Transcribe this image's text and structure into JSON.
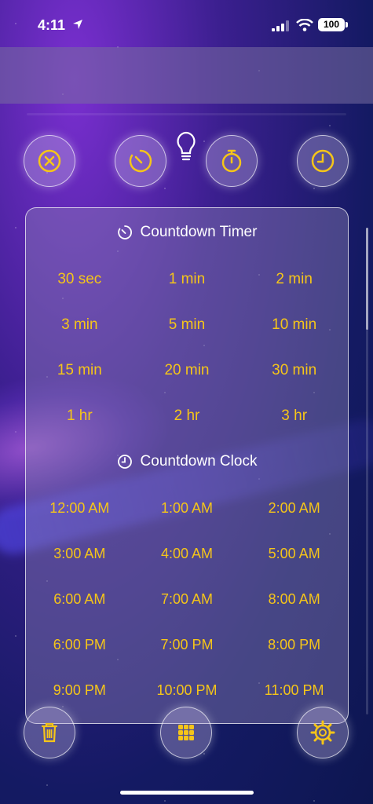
{
  "status_bar": {
    "time": "4:11",
    "battery": "100"
  },
  "top_buttons": [
    {
      "name": "close",
      "icon": "close-circle-icon"
    },
    {
      "name": "timer",
      "icon": "timer-icon"
    },
    {
      "name": "stopwatch",
      "icon": "stopwatch-icon"
    },
    {
      "name": "clock",
      "icon": "clock-icon"
    }
  ],
  "countdown_timer": {
    "title": "Countdown Timer",
    "items": [
      "30 sec",
      "1 min",
      "2 min",
      "3 min",
      "5 min",
      "10 min",
      "15 min",
      "20 min",
      "30 min",
      "1 hr",
      "2 hr",
      "3 hr"
    ]
  },
  "countdown_clock": {
    "title": "Countdown Clock",
    "items": [
      "12:00 AM",
      "1:00 AM",
      "2:00 AM",
      "3:00 AM",
      "4:00 AM",
      "5:00 AM",
      "6:00 AM",
      "7:00 AM",
      "8:00 AM",
      "6:00 PM",
      "7:00 PM",
      "8:00 PM",
      "9:00 PM",
      "10:00 PM",
      "11:00 PM"
    ]
  },
  "bottom_buttons": [
    {
      "name": "delete",
      "icon": "trash-icon"
    },
    {
      "name": "apps",
      "icon": "grid-dots-icon"
    },
    {
      "name": "settings",
      "icon": "gear-icon"
    }
  ],
  "colors": {
    "accent": "#f5c519"
  }
}
